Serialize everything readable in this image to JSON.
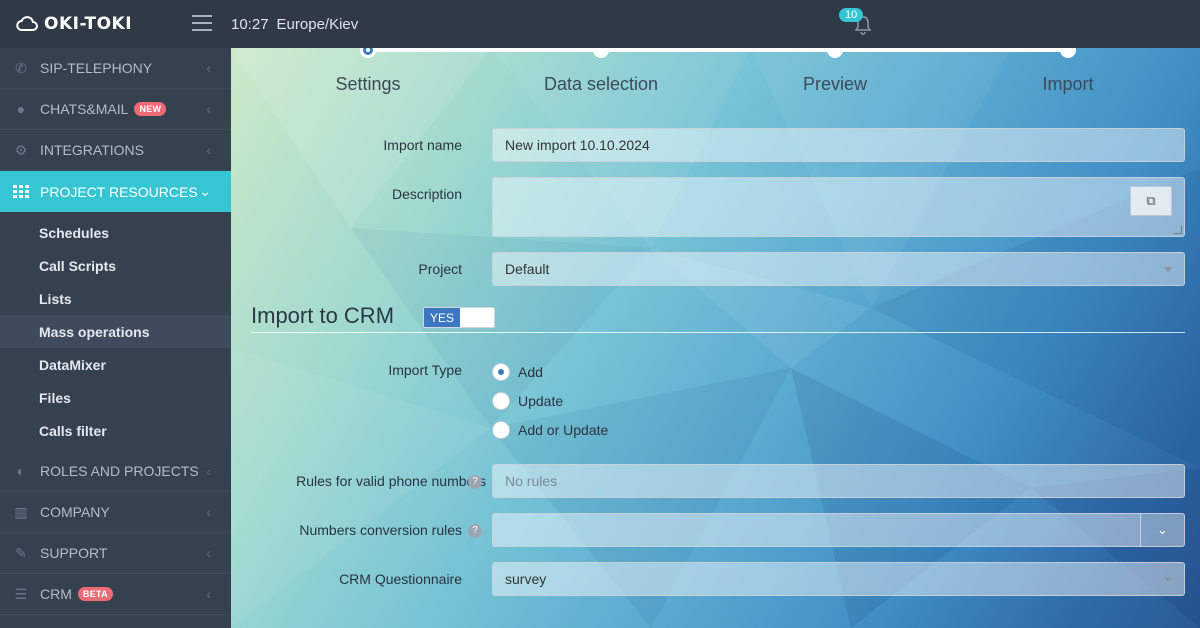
{
  "app": {
    "logo": "OKI-TOKI",
    "time": "10:27",
    "timezone": "Europe/Kiev",
    "notifications": "10"
  },
  "sidebar": {
    "items": [
      {
        "label": "SIP-TELEPHONY",
        "icon": "phone-icon"
      },
      {
        "label": "CHATS&MAIL",
        "icon": "chat-icon",
        "badge": "NEW"
      },
      {
        "label": "INTEGRATIONS",
        "icon": "gears-icon"
      },
      {
        "label": "PROJECT RESOURCES",
        "icon": "grid-icon"
      },
      {
        "label": "ROLES AND PROJECTS",
        "icon": "toggle-icon"
      },
      {
        "label": "COMPANY",
        "icon": "bar-chart-icon"
      },
      {
        "label": "SUPPORT",
        "icon": "wrench-icon"
      },
      {
        "label": "CRM",
        "icon": "list-icon",
        "badge": "BETA"
      }
    ],
    "subitems": [
      "Schedules",
      "Call Scripts",
      "Lists",
      "Mass operations",
      "DataMixer",
      "Files",
      "Calls filter"
    ]
  },
  "steps": [
    "Settings",
    "Data selection",
    "Preview",
    "Import"
  ],
  "form": {
    "import_name_label": "Import name",
    "import_name_value": "New import 10.10.2024",
    "description_label": "Description",
    "project_label": "Project",
    "project_value": "Default",
    "section_title": "Import to CRM",
    "toggle_on": "YES",
    "import_type_label": "Import Type",
    "import_types": [
      "Add",
      "Update",
      "Add or Update"
    ],
    "rules_label": "Rules for valid phone numbers",
    "rules_placeholder": "No rules",
    "conversion_label": "Numbers conversion rules",
    "questionnaire_label": "CRM Questionnaire",
    "questionnaire_value": "survey"
  },
  "colors": {
    "accent": "#36c6d3",
    "primary": "#3b78c1",
    "badge": "#ed6b75"
  }
}
